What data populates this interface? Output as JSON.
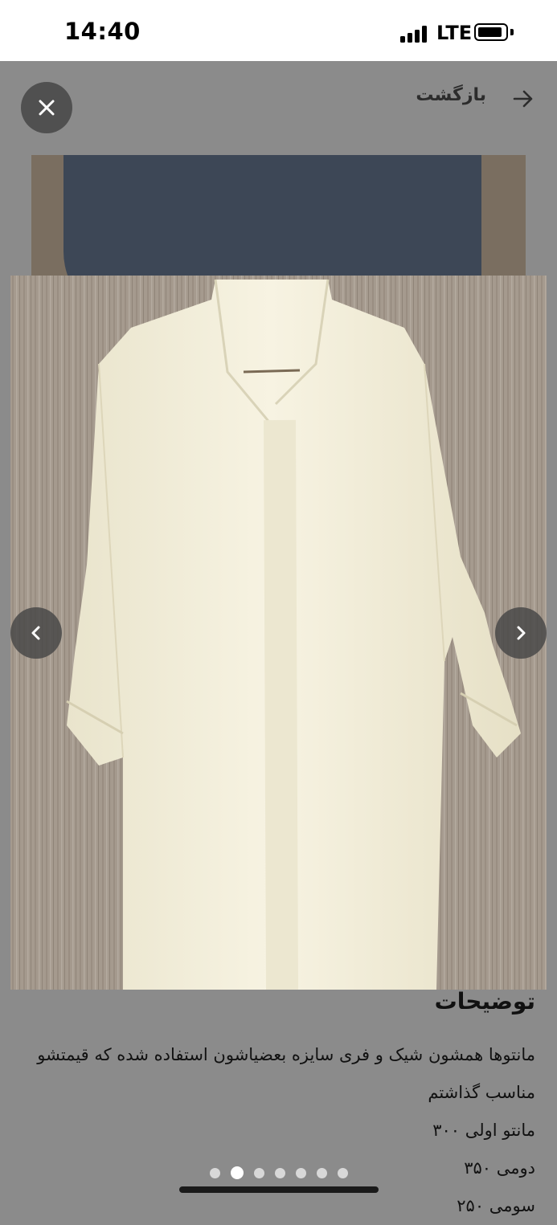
{
  "status_bar": {
    "time": "14:40",
    "network": "LTE"
  },
  "header": {
    "back_label": "بازگشت",
    "back_icon": "arrow-right-icon",
    "close_icon": "close-icon"
  },
  "gallery": {
    "prev_icon": "chevron-left-icon",
    "next_icon": "chevron-right-icon",
    "total_images": 7,
    "current_index": 2
  },
  "description": {
    "title": "توضیحات",
    "lines": [
      "مانتوها همشون شیک و فری سایزه بعضیاشون استفاده شده که قیمتشو",
      "مناسب گذاشتم",
      "مانتو اولی ۳۰۰",
      "دومی ۳۵۰",
      "سومی ۲۵۰"
    ]
  },
  "colors": {
    "overlay": "#8b8b8b",
    "coat": "#f4f0dc",
    "wood": "#a3968a"
  }
}
